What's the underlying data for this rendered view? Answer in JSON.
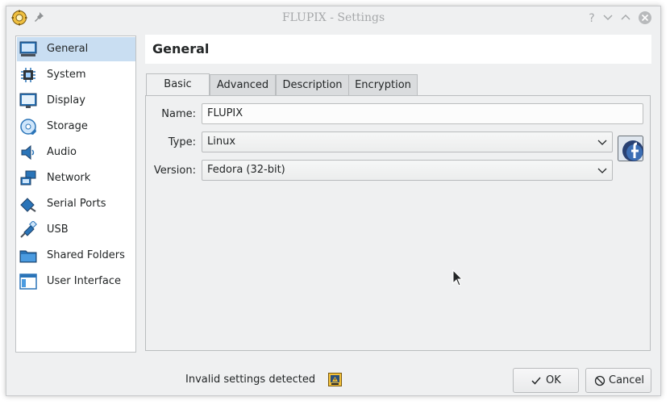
{
  "window": {
    "title": "FLUPIX - Settings",
    "controls": [
      "help-icon",
      "minimize-icon",
      "close-icon"
    ]
  },
  "sidebar": {
    "items": [
      {
        "label": "General",
        "icon": "general-monitor-icon",
        "selected": true
      },
      {
        "label": "System",
        "icon": "chip-icon"
      },
      {
        "label": "Display",
        "icon": "display-icon"
      },
      {
        "label": "Storage",
        "icon": "storage-disc-icon"
      },
      {
        "label": "Audio",
        "icon": "speaker-icon"
      },
      {
        "label": "Network",
        "icon": "network-icon"
      },
      {
        "label": "Serial Ports",
        "icon": "serial-port-icon"
      },
      {
        "label": "USB",
        "icon": "usb-icon"
      },
      {
        "label": "Shared Folders",
        "icon": "folder-icon"
      },
      {
        "label": "User Interface",
        "icon": "user-interface-icon"
      }
    ]
  },
  "header": {
    "title": "General"
  },
  "tabs": [
    {
      "label": "Basic",
      "active": true
    },
    {
      "label": "Advanced"
    },
    {
      "label": "Description"
    },
    {
      "label": "Encryption"
    }
  ],
  "form": {
    "name_label": "Name:",
    "name_value": "FLUPIX",
    "type_label": "Type:",
    "type_value": "Linux",
    "version_label": "Version:",
    "version_value": "Fedora (32-bit)",
    "os_icon": "fedora-logo-icon"
  },
  "status": {
    "text": "Invalid settings detected",
    "icon": "warning-icon"
  },
  "buttons": {
    "ok_label": "OK",
    "cancel_label": "Cancel"
  },
  "colors": {
    "selection": "#c9def2",
    "window_bg": "#eff0f1",
    "title_text": "#a6a8aa"
  }
}
